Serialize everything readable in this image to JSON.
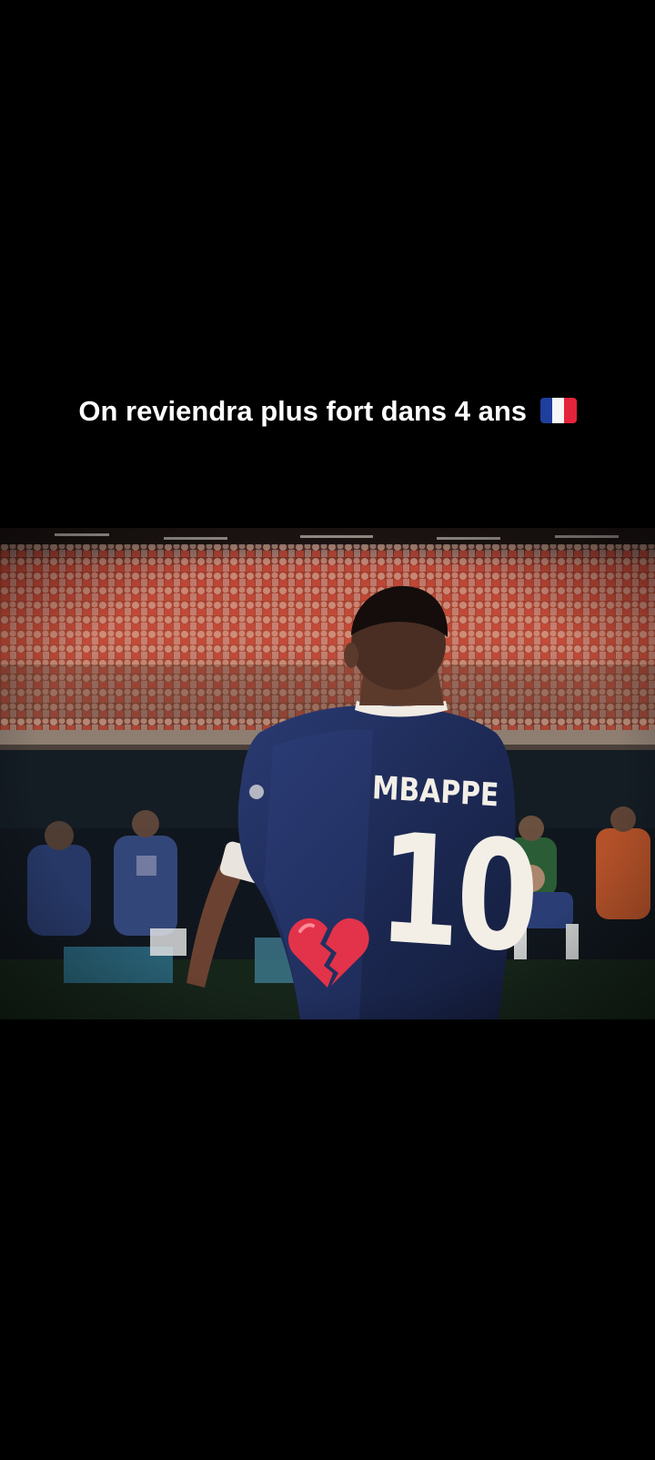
{
  "caption": {
    "text": "On reviendra plus fort dans 4 ans",
    "emoji": "flag-france-icon"
  },
  "photo": {
    "subject": "football-player-back-view",
    "jersey_name": "MBAPPE",
    "jersey_number": "10",
    "sticker": "broken-heart-icon"
  },
  "colors": {
    "background": "#000000",
    "caption_text": "#ffffff",
    "jersey_blue": "#1e2c5a",
    "crowd_red": "#b8432f",
    "broken_heart": "#e2334a"
  }
}
